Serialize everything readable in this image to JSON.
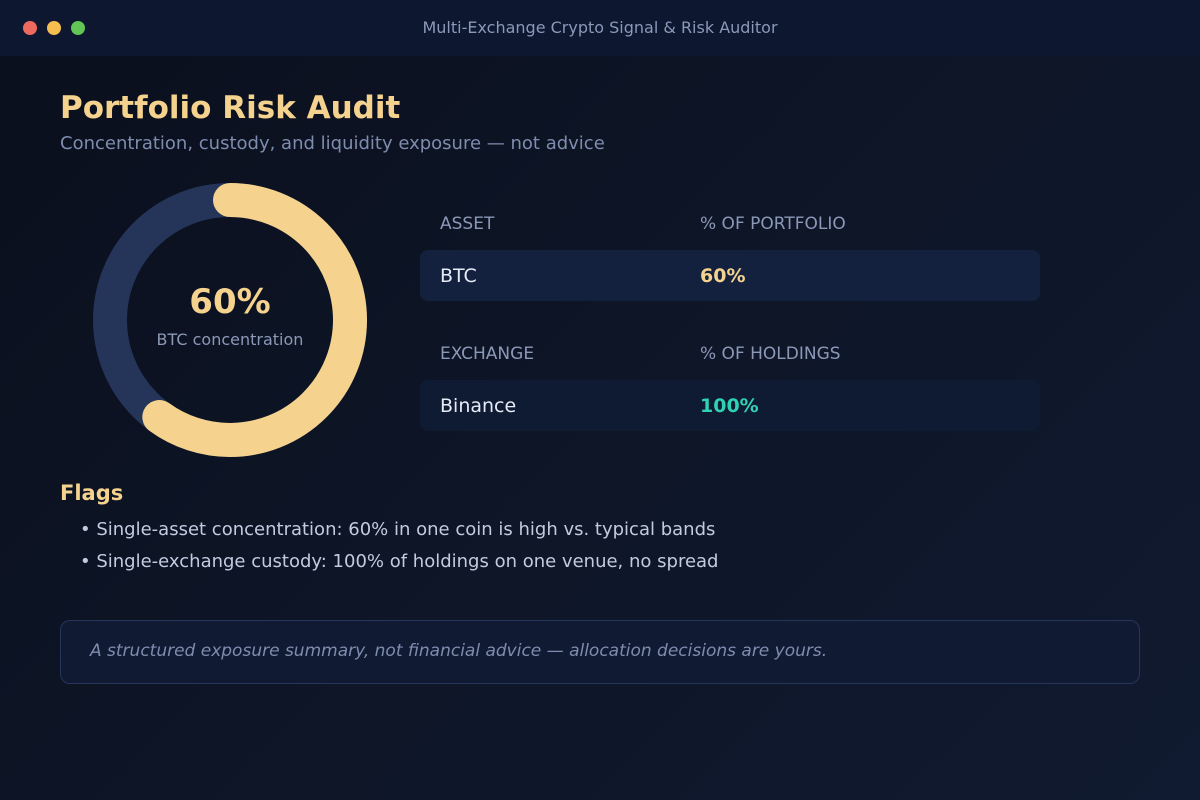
{
  "window": {
    "title": "Multi-Exchange Crypto Signal & Risk Auditor",
    "controls": [
      {
        "icon": "close-dot-icon",
        "color": "#ee6a5f"
      },
      {
        "icon": "minimize-dot-icon",
        "color": "#f5be4f"
      },
      {
        "icon": "maximize-dot-icon",
        "color": "#62c554"
      }
    ]
  },
  "header": {
    "title": "Portfolio Risk Audit",
    "subtitle": "Concentration, custody, and liquidity exposure — not advice"
  },
  "donut": {
    "value_text": "60%",
    "label": "BTC concentration",
    "fraction": 0.6,
    "fill_color": "#f5d38e",
    "track_color": "#253459"
  },
  "asset_table": {
    "headers": [
      "ASSET",
      "% OF PORTFOLIO"
    ],
    "rows": [
      {
        "asset": "BTC",
        "percent": "60%",
        "color": "#f5d38e"
      }
    ]
  },
  "exchange_table": {
    "headers": [
      "EXCHANGE",
      "% OF HOLDINGS"
    ],
    "rows": [
      {
        "exchange": "Binance",
        "percent": "100%",
        "color": "#2fd3b4"
      }
    ]
  },
  "flags": {
    "title": "Flags",
    "items": [
      "• Single-asset concentration: 60% in one coin is high vs. typical bands",
      "• Single-exchange custody: 100% of holdings on one venue, no spread"
    ]
  },
  "disclaimer": "A structured exposure summary, not financial advice — allocation decisions are yours."
}
